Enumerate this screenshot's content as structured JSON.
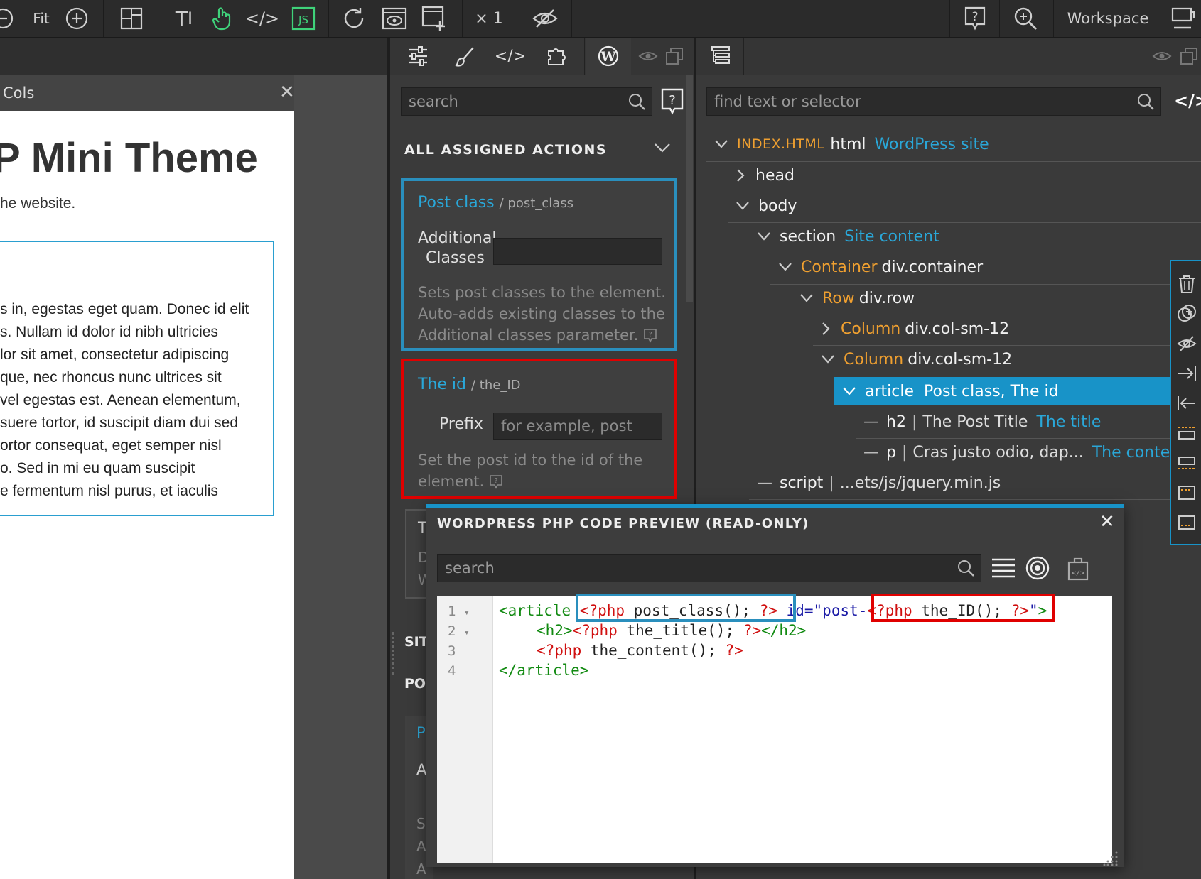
{
  "toolbar": {
    "fit_label": "Fit",
    "multiplier": "× 1",
    "workspace_label": "Workspace"
  },
  "canvas": {
    "panel_title": "Cols",
    "heading": "P Mini Theme",
    "subtext": "he website.",
    "paragraph_lines": [
      "s in, egestas eget quam. Donec id elit",
      "s. Nullam id dolor id nibh ultricies",
      "lor sit amet, consectetur adipiscing",
      "que, nec rhoncus nunc ultrices sit",
      "vel egestas est. Aenean elementum,",
      "suere tortor, id suscipit diam dui sed",
      "ortor consequat, eget semper nisl",
      "o. Sed in mi eu quam suscipit",
      "e fermentum nisl purus, et iaculis"
    ]
  },
  "actions_panel": {
    "search_placeholder": "search",
    "section_title": "ALL ASSIGNED ACTIONS",
    "cards": [
      {
        "title": "Post class",
        "slug": "/ post_class",
        "field_label_1": "Additional",
        "field_label_2": "Classes",
        "field_value": "",
        "desc_lines": [
          "Sets post classes to the element.",
          "Auto-adds existing classes to the",
          "Additional classes parameter."
        ]
      },
      {
        "title": "The id",
        "slug": "/ the_ID",
        "field_label": "Prefix",
        "field_placeholder": "for example, post",
        "desc_lines": [
          "Set the post id to the id of the",
          "element."
        ]
      }
    ],
    "partial_letters": [
      "T",
      "D",
      "W",
      "SIT",
      "PO",
      "P",
      "A",
      "S",
      "A",
      "A"
    ]
  },
  "tree_panel": {
    "search_placeholder": "find text or selector",
    "nodes": [
      {
        "name": "INDEX.HTML",
        "tag": "html",
        "label": "WordPress site"
      },
      {
        "tag": "head"
      },
      {
        "tag": "body"
      },
      {
        "tag": "section",
        "label": "Site content"
      },
      {
        "name": "Container",
        "tag": "div.container"
      },
      {
        "name": "Row",
        "tag": "div.row"
      },
      {
        "name": "Column",
        "tag": "div.col-sm-12"
      },
      {
        "name": "Column",
        "tag": "div.col-sm-12"
      },
      {
        "tag": "article",
        "label": "Post class, The id"
      },
      {
        "tag": "h2",
        "text": "The Post Title",
        "label": "The title"
      },
      {
        "tag": "p",
        "text": "Cras justo odio, dap...",
        "label": "The content"
      },
      {
        "tag": "script",
        "text": "...ets/js/jquery.min.js"
      }
    ]
  },
  "code_preview": {
    "title": "WORDPRESS PHP CODE PREVIEW (READ-ONLY)",
    "search_placeholder": "search",
    "line_numbers": [
      "1",
      "2",
      "3",
      "4"
    ],
    "line1": {
      "a": "<article ",
      "php_open": "<?php",
      "fn": " post_class(); ",
      "php_close": "?>",
      "attr": " id=\"post-",
      "php_open2": "<?php",
      "fn2": " the_ID(); ",
      "php_close2": "?>",
      "end_quote": "\"",
      "end": ">"
    },
    "line2": {
      "a": "<h2>",
      "php_open": "<?php",
      "fn": " the_title(); ",
      "php_close": "?>",
      "end": "</h2>"
    },
    "line3": {
      "php_open": "<?php",
      "fn": " the_content(); ",
      "php_close": "?>"
    },
    "line4": "</article>"
  },
  "colors": {
    "accent_blue": "#1893c8",
    "highlight_red": "#e00000",
    "highlight_blue": "#2a8fbd"
  }
}
